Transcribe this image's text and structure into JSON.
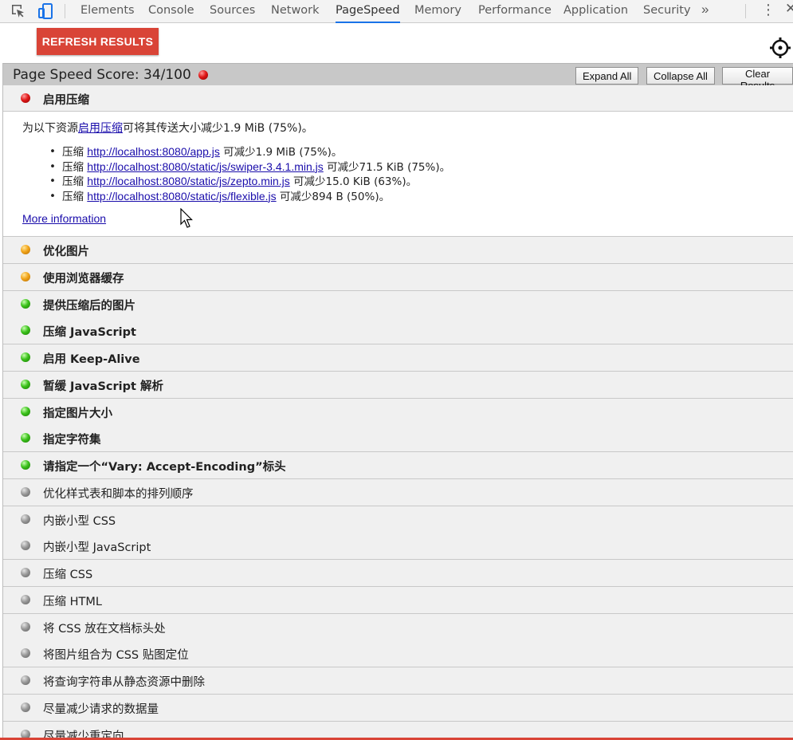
{
  "tabs": [
    "Elements",
    "Console",
    "Sources",
    "Network",
    "PageSpeed",
    "Memory",
    "Performance",
    "Application",
    "Security"
  ],
  "active_tab": "PageSpeed",
  "toolbar": {
    "refresh_label": "REFRESH RESULTS"
  },
  "score": {
    "label": "Page Speed Score: 34/100",
    "status_color": "red"
  },
  "buttons": {
    "expand_all": "Expand All",
    "collapse_all": "Collapse All",
    "clear_results": "Clear Results"
  },
  "expanded_rule": {
    "title": "启用压缩",
    "status": "red",
    "summary_prefix": "为以下资源",
    "summary_link": "启用压缩",
    "summary_suffix": "可将其传送大小减少1.9 MiB (75%)。",
    "details": [
      {
        "prefix": "压缩 ",
        "url": "http://localhost:8080/app.js",
        "suffix": " 可减少1.9 MiB (75%)。"
      },
      {
        "prefix": "压缩 ",
        "url": "http://localhost:8080/static/js/swiper-3.4.1.min.js",
        "suffix": " 可减少71.5 KiB (75%)。"
      },
      {
        "prefix": "压缩 ",
        "url": "http://localhost:8080/static/js/zepto.min.js",
        "suffix": " 可减少15.0 KiB (63%)。"
      },
      {
        "prefix": "压缩 ",
        "url": "http://localhost:8080/static/js/flexible.js",
        "suffix": " 可减少894 B (50%)。"
      }
    ],
    "more_info": "More information"
  },
  "rules": [
    {
      "title": "优化图片",
      "status": "orange",
      "bold": true
    },
    {
      "title": "使用浏览器缓存",
      "status": "orange",
      "bold": true
    },
    {
      "title": "提供压缩后的图片",
      "status": "green",
      "bold": true
    },
    {
      "title": "压缩 JavaScript",
      "status": "green",
      "bold": true
    },
    {
      "title": "启用 Keep-Alive",
      "status": "green",
      "bold": true
    },
    {
      "title": "暂缓 JavaScript 解析",
      "status": "green",
      "bold": true
    },
    {
      "title": "指定图片大小",
      "status": "green",
      "bold": true
    },
    {
      "title": "指定字符集",
      "status": "green",
      "bold": true
    },
    {
      "title": "请指定一个“Vary: Accept-Encoding”标头",
      "status": "green",
      "bold": true
    },
    {
      "title": "优化样式表和脚本的排列顺序",
      "status": "gray",
      "bold": false
    },
    {
      "title": "内嵌小型 CSS",
      "status": "gray",
      "bold": false
    },
    {
      "title": "内嵌小型 JavaScript",
      "status": "gray",
      "bold": false
    },
    {
      "title": "压缩 CSS",
      "status": "gray",
      "bold": false
    },
    {
      "title": "压缩 HTML",
      "status": "gray",
      "bold": false
    },
    {
      "title": "将 CSS 放在文档标头处",
      "status": "gray",
      "bold": false
    },
    {
      "title": "将图片组合为 CSS 贴图定位",
      "status": "gray",
      "bold": false
    },
    {
      "title": "将查询字符串从静态资源中删除",
      "status": "gray",
      "bold": false
    },
    {
      "title": "尽量减少请求的数据量",
      "status": "gray",
      "bold": false
    },
    {
      "title": "尽量减少重定向",
      "status": "gray",
      "bold": false
    }
  ],
  "colors": {
    "accent": "#d94437",
    "link": "#1a0dab",
    "active_tab_underline": "#1a73e8"
  }
}
